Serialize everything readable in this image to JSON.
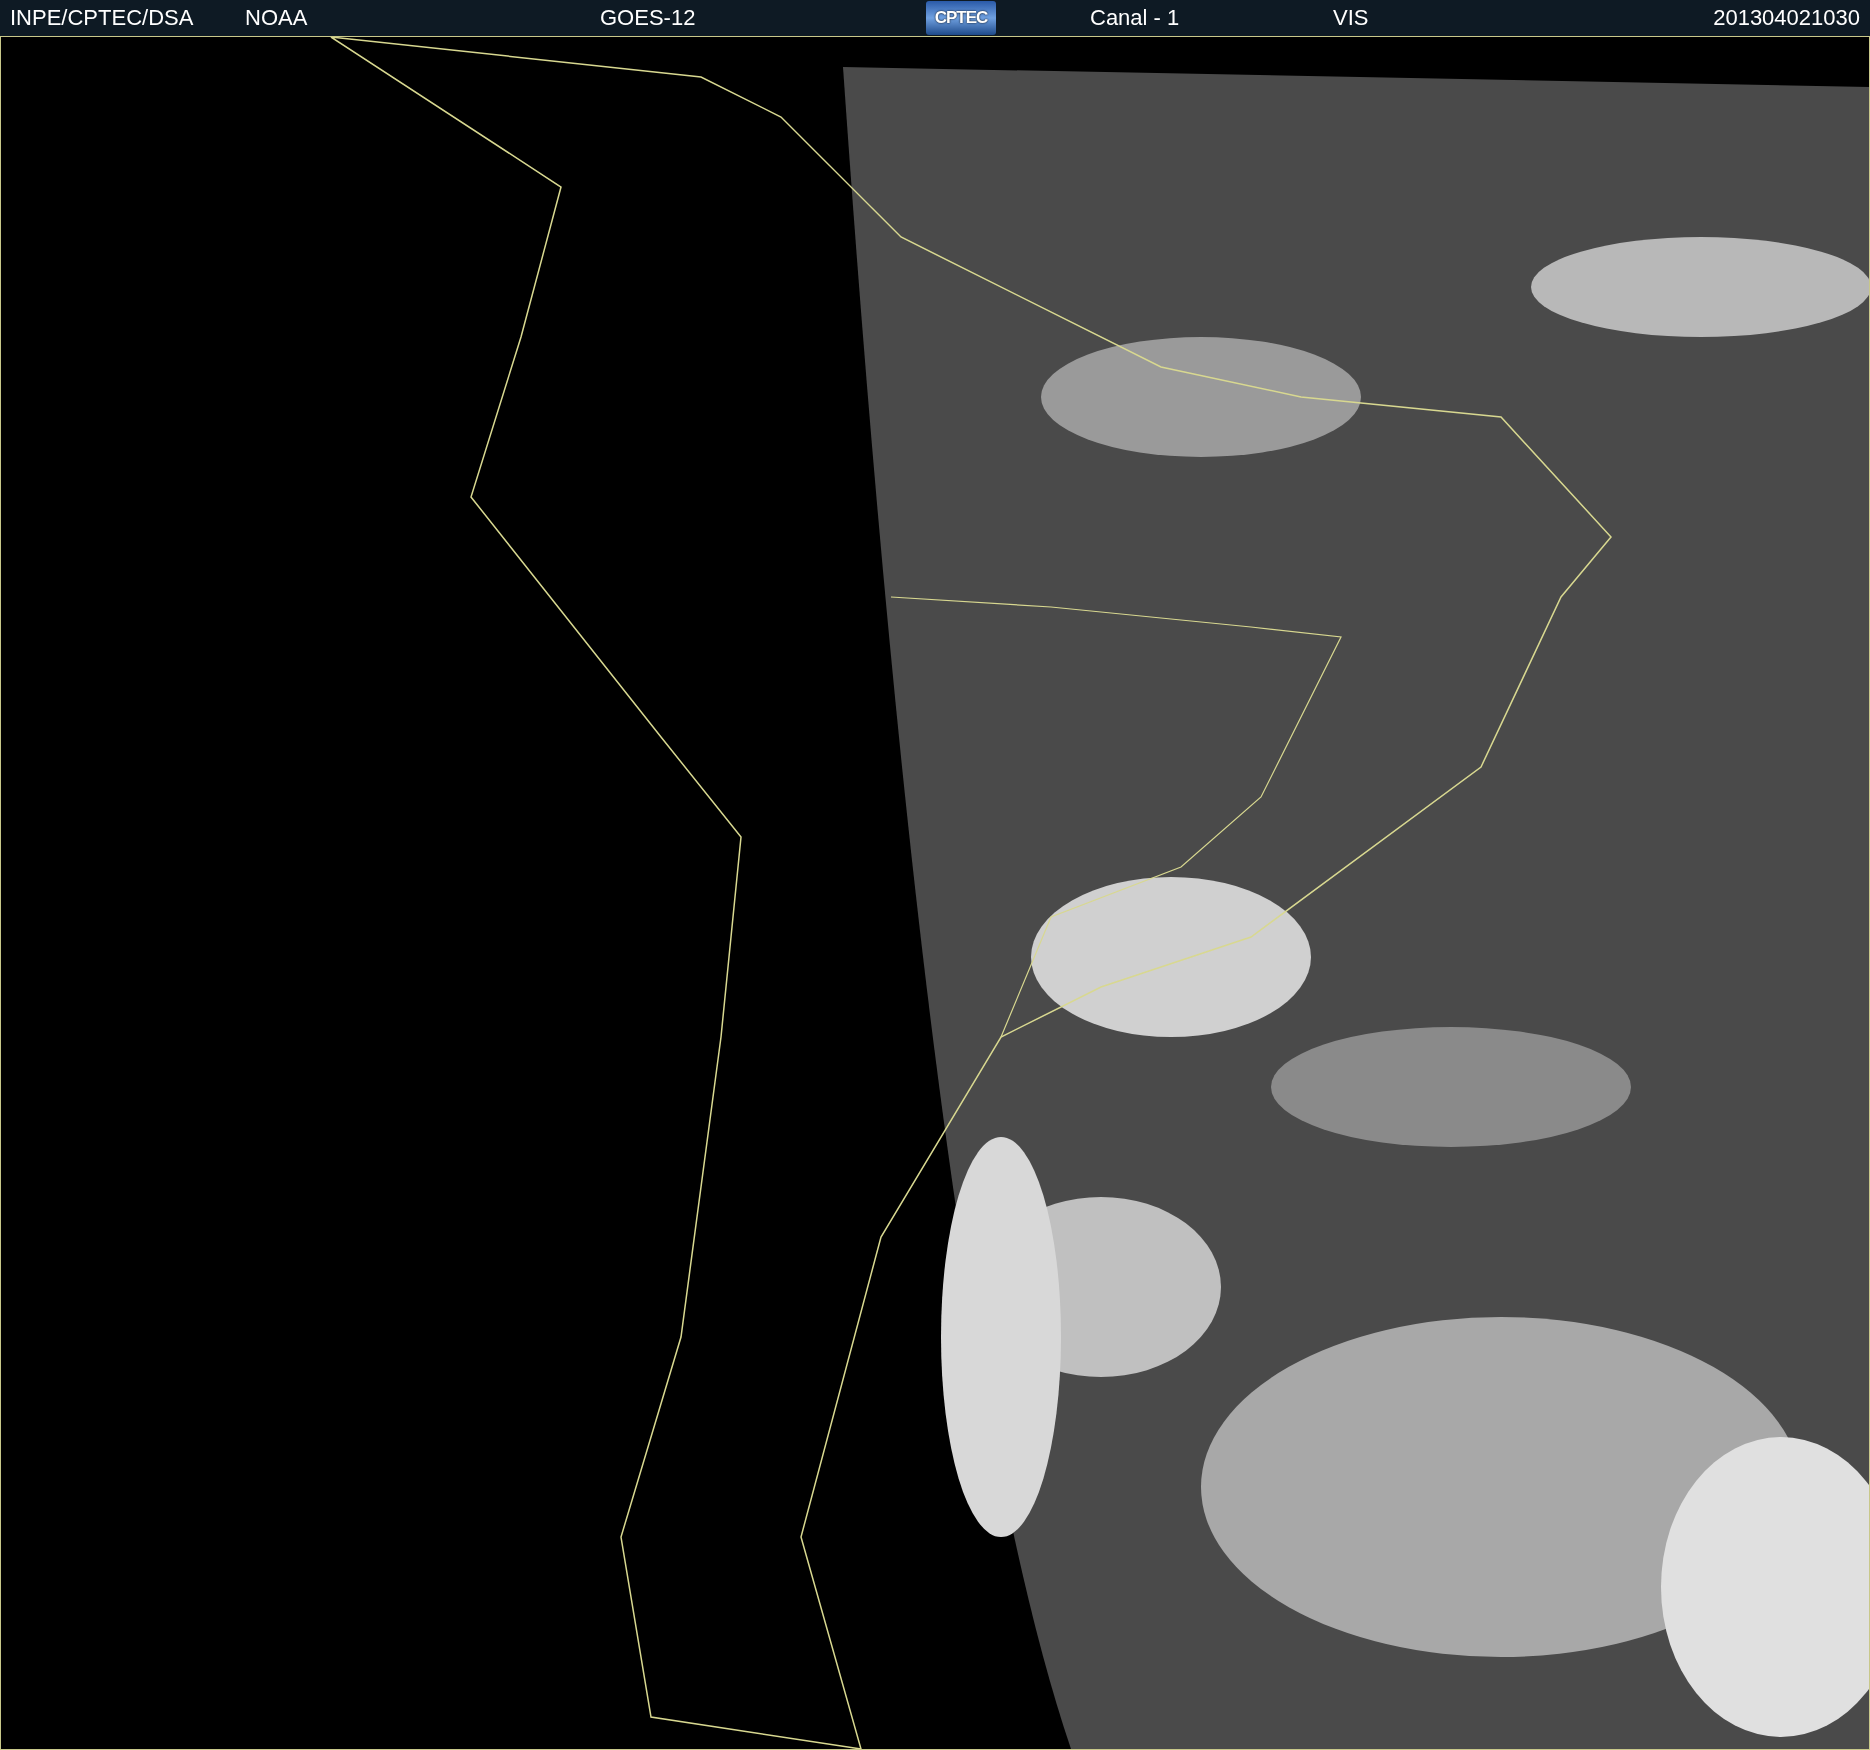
{
  "header": {
    "items": [
      {
        "kind": "text",
        "text": "INPE/CPTEC/DSA"
      },
      {
        "kind": "text",
        "text": "NOAA"
      },
      {
        "kind": "text",
        "text": "GOES-12"
      },
      {
        "kind": "logo",
        "text": "CPTEC"
      },
      {
        "kind": "text",
        "text": "Canal - 1"
      },
      {
        "kind": "text",
        "text": "VIS"
      },
      {
        "kind": "text",
        "text": "201304021030"
      }
    ]
  }
}
